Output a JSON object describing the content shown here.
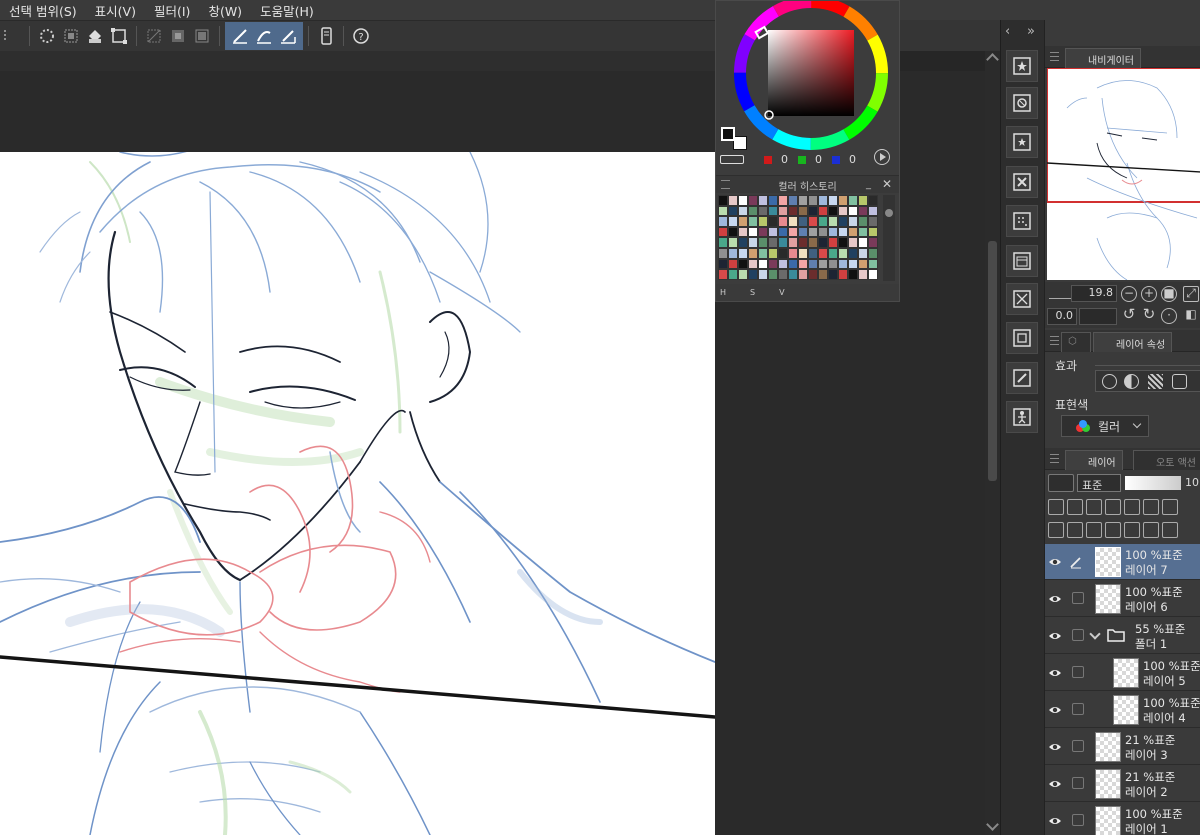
{
  "menu": [
    "선택 범위(S)",
    "표시(V)",
    "필터(I)",
    "창(W)",
    "도움말(H)"
  ],
  "color_panel": {
    "rgb": {
      "r": "0",
      "g": "0",
      "b": "0"
    },
    "history_title": "컬러 히스토리",
    "footer": [
      "H",
      "S",
      "V"
    ]
  },
  "navigator": {
    "tab_label": "내비게이터",
    "zoom": "19.8",
    "rotation": "0.0"
  },
  "layer_property": {
    "tab_label": "레이어 속성",
    "effect_label": "효과",
    "expression_label": "표현색",
    "expression_value": "컬러"
  },
  "layer_panel": {
    "tab_label": "레이어",
    "tab2_label": "오토 액션",
    "blend_mode": "표준",
    "opacity": "10",
    "layers": [
      {
        "mode": "100 %표준",
        "name": "레이어 7",
        "selected": true
      },
      {
        "mode": "100 %표준",
        "name": "레이어 6"
      },
      {
        "mode": "55 %표준",
        "name": "폴더 1",
        "folder": true
      },
      {
        "mode": "100 %표준",
        "name": "레이어 5",
        "indent": true
      },
      {
        "mode": "100 %표준",
        "name": "레이어 4",
        "indent": true
      },
      {
        "mode": "21 %표준",
        "name": "레이어 3"
      },
      {
        "mode": "21 %표준",
        "name": "레이어 2"
      },
      {
        "mode": "100 %표준",
        "name": "레이어 1"
      }
    ]
  },
  "colors": {
    "panel_bg": "#3a3a3a",
    "selected_layer": "#566f92",
    "sketch_blue": "#6f93c8",
    "sketch_red": "#e88a8f",
    "sketch_green": "#b9dcae"
  }
}
